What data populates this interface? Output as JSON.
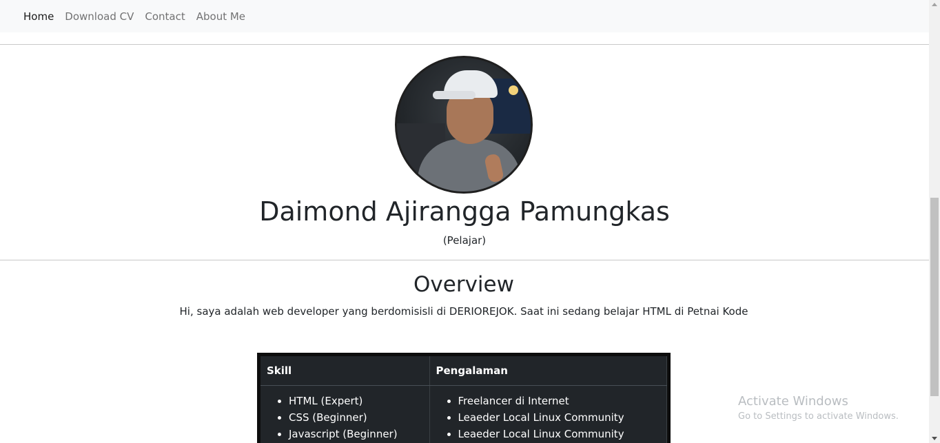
{
  "nav": {
    "items": [
      {
        "label": "Home",
        "active": true
      },
      {
        "label": "Download CV",
        "active": false
      },
      {
        "label": "Contact",
        "active": false
      },
      {
        "label": "About Me",
        "active": false
      }
    ]
  },
  "profile": {
    "name": "Daimond Ajirangga Pamungkas",
    "role": "(Pelajar)"
  },
  "overview": {
    "title": "Overview",
    "text": "Hi, saya adalah web developer yang berdomisisli di DERIOREJOK. Saat ini sedang belajar HTML di Petnai Kode"
  },
  "table": {
    "headers": [
      "Skill",
      "Pengalaman"
    ],
    "skills": [
      "HTML (Expert)",
      "CSS (Beginner)",
      "Javascript (Beginner)"
    ],
    "experience": [
      "Freelancer di Internet",
      "Leaeder Local Linux Community",
      "Leaeder Local Linux Community"
    ]
  },
  "watermark": {
    "title": "Activate Windows",
    "subtitle": "Go to Settings to activate Windows."
  },
  "colors": {
    "navbar_bg": "#f8f9fa",
    "table_bg": "#212529",
    "text": "#212529"
  }
}
